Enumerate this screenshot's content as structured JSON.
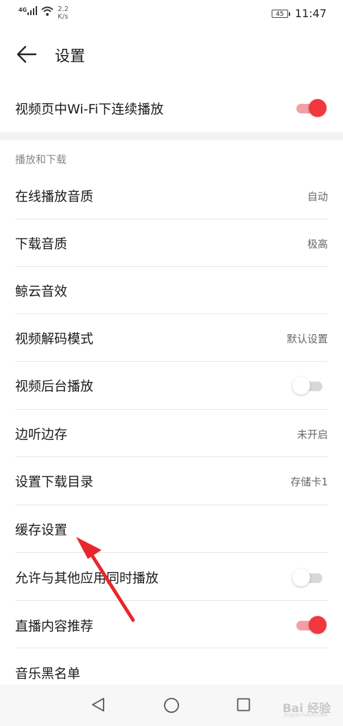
{
  "status_bar": {
    "network": "4G",
    "speed_value": "2.2",
    "speed_unit": "K/s",
    "battery": "45",
    "time": "11:47"
  },
  "header": {
    "title": "设置",
    "back_icon": "back-arrow-icon"
  },
  "top_setting": {
    "label": "视频页中Wi-Fi下连续播放",
    "toggle_on": true
  },
  "section": {
    "title": "播放和下载",
    "items": [
      {
        "label": "在线播放音质",
        "value": "自动"
      },
      {
        "label": "下载音质",
        "value": "极高"
      },
      {
        "label": "鲸云音效",
        "value": ""
      },
      {
        "label": "视频解码模式",
        "value": "默认设置"
      },
      {
        "label": "视频后台播放",
        "toggle_on": false
      },
      {
        "label": "边听边存",
        "value": "未开启"
      },
      {
        "label": "设置下载目录",
        "value": "存储卡1"
      },
      {
        "label": "缓存设置",
        "value": ""
      },
      {
        "label": "允许与其他应用同时播放",
        "toggle_on": false
      },
      {
        "label": "直播内容推荐",
        "toggle_on": true
      },
      {
        "label": "音乐黑名单",
        "value": ""
      }
    ]
  },
  "nav_bar": {
    "icons": [
      "triangle-back-icon",
      "circle-home-icon",
      "square-recent-icon"
    ],
    "watermark": "Bai 经验",
    "watermark_sub": "jingyan.baidu.com"
  },
  "colors": {
    "accent": "#f0383e",
    "accent_track": "#f4a0a3",
    "annotation_arrow": "#e8262b"
  }
}
